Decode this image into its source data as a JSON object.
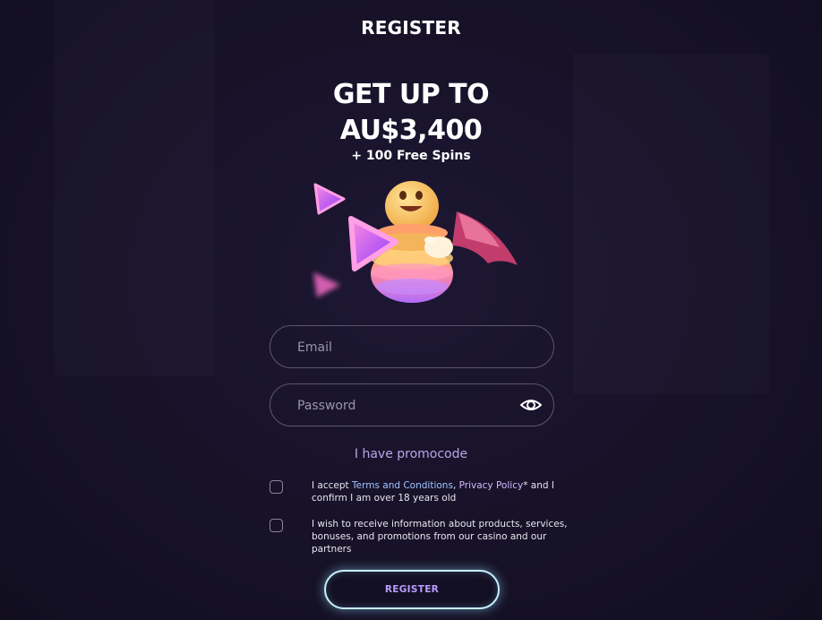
{
  "header": {
    "title": "REGISTER"
  },
  "bonus": {
    "line1": "GET UP TO",
    "line2": "AU$3,400",
    "extra": "+ 100 Free Spins"
  },
  "form": {
    "email_placeholder": "Email",
    "password_placeholder": "Password",
    "promo_link": "I have promocode",
    "terms": {
      "prefix": "I accept ",
      "terms_link": "Terms and Conditions",
      "separator": ", ",
      "privacy_link": "Privacy Policy",
      "suffix": "* and I confirm I am over 18 years old"
    },
    "marketing_consent": "I wish to receive information about products, services, bonuses, and promotions from our casino and our partners",
    "submit_label": "REGISTER"
  },
  "icons": {
    "password_toggle": "eye-icon",
    "mascot": "mascot-illustration"
  },
  "colors": {
    "background": "#17122a",
    "accent_purple": "#b99cff",
    "link_blue": "#9fc2ff",
    "button_glow": "#c8f0ff"
  }
}
